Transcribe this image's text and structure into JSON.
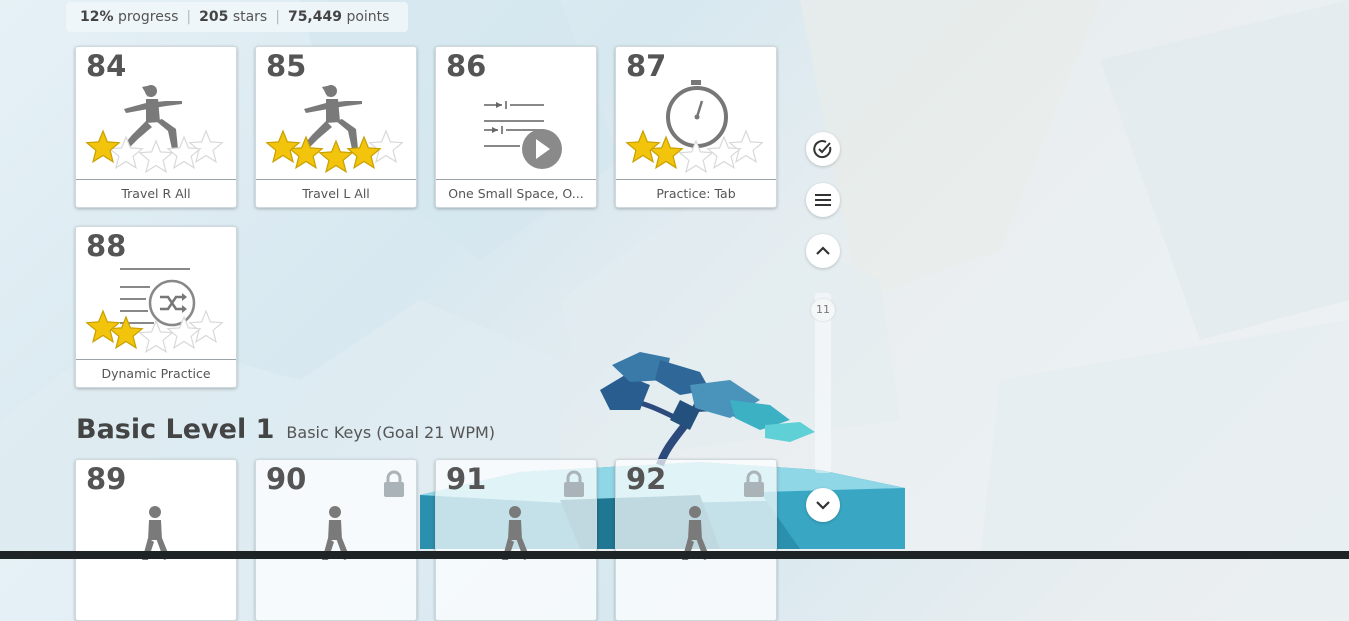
{
  "stats": {
    "progress_value": "12%",
    "progress_label": "progress",
    "stars_value": "205",
    "stars_label": "stars",
    "points_value": "75,449",
    "points_label": "points",
    "separator": "|"
  },
  "lessons": [
    {
      "number": "84",
      "label": "Travel R All",
      "stars_earned": 1,
      "stars_total": 5,
      "icon": "warrior-pose-icon"
    },
    {
      "number": "85",
      "label": "Travel L All",
      "stars_earned": 4,
      "stars_total": 5,
      "icon": "warrior-pose-icon"
    },
    {
      "number": "86",
      "label": "One Small Space, O...",
      "stars_earned": 0,
      "icon": "tab-video-icon"
    },
    {
      "number": "87",
      "label": "Practice: Tab",
      "stars_earned": 2,
      "stars_total": 5,
      "icon": "stopwatch-icon"
    },
    {
      "number": "88",
      "label": "Dynamic Practice",
      "stars_earned": 2,
      "stars_total": 5,
      "icon": "shuffle-icon"
    }
  ],
  "section": {
    "title": "Basic Level 1",
    "subtitle": "Basic Keys (Goal 21 WPM)"
  },
  "basic_lessons": [
    {
      "number": "89",
      "locked": false,
      "icon": "walking-person-icon"
    },
    {
      "number": "90",
      "locked": true,
      "icon": "walking-person-icon"
    },
    {
      "number": "91",
      "locked": true,
      "icon": "walking-person-icon"
    },
    {
      "number": "92",
      "locked": true,
      "icon": "walking-person-icon"
    }
  ],
  "controls": {
    "page_number": "11",
    "icons": [
      "check-circle-icon",
      "menu-icon",
      "chevron-up-icon",
      "chevron-down-icon"
    ]
  },
  "colors": {
    "star_gold": "#f2c40c",
    "text_dark": "#555555",
    "icon_gray": "#777777"
  }
}
